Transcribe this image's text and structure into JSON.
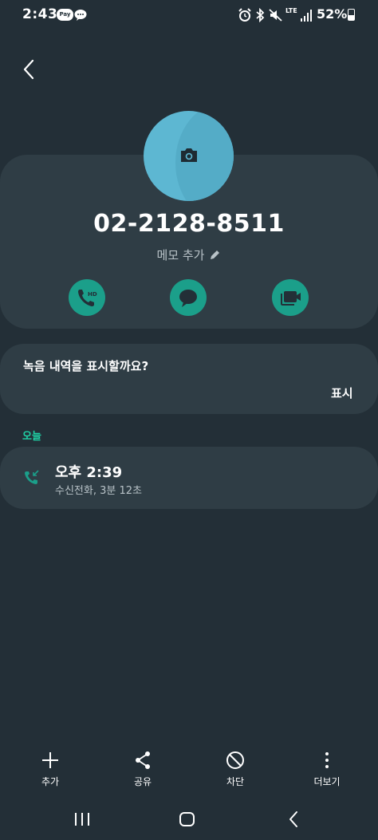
{
  "status": {
    "time": "2:43",
    "pay_badge": "Pay",
    "battery": "52%",
    "network": "LTE",
    "icons": [
      "pay-icon",
      "talk-icon",
      "alarm-icon",
      "bluetooth-icon",
      "mute-icon",
      "lte-icon",
      "signal-icon",
      "battery-icon"
    ]
  },
  "contact": {
    "phone_number": "02-2128-8511",
    "memo_label": "메모 추가",
    "actions": [
      "hd-call-icon",
      "message-icon",
      "video-call-icon"
    ]
  },
  "recording": {
    "question": "녹음 내역을 표시할까요?",
    "show_label": "표시"
  },
  "history": {
    "section_label": "오늘",
    "items": [
      {
        "time": "오후 2:39",
        "detail": "수신전화, 3분 12초",
        "icon": "incoming-call-icon"
      }
    ]
  },
  "bottom_bar": {
    "add": "추가",
    "share": "공유",
    "block": "차단",
    "more": "더보기"
  },
  "colors": {
    "background": "#232f37",
    "card": "#2f3d45",
    "accent": "#1b9f8a",
    "today": "#1fd2a6",
    "avatar": "#5db7d2"
  }
}
